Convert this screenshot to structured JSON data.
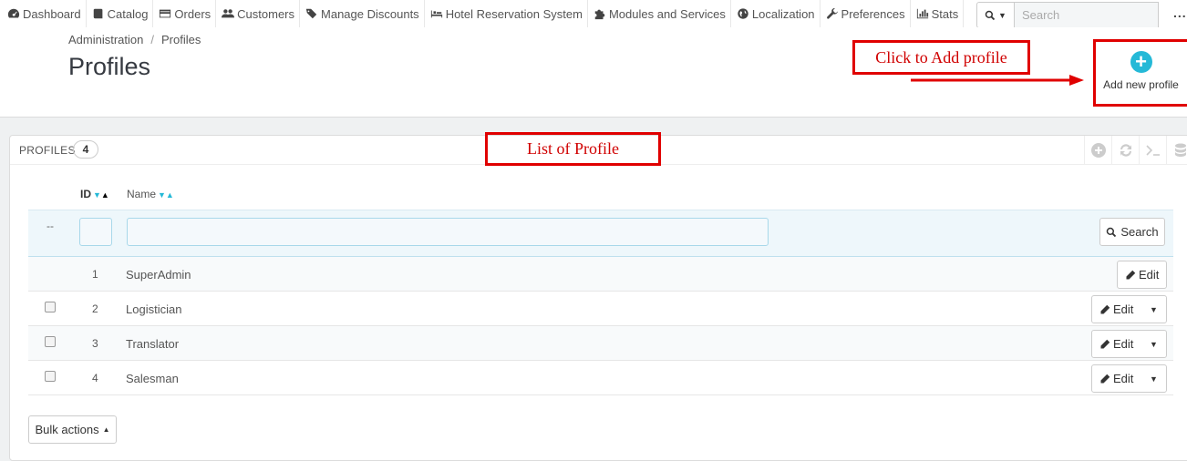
{
  "nav": {
    "items": [
      {
        "label": "Dashboard",
        "icon": "dashboard-icon"
      },
      {
        "label": "Catalog",
        "icon": "book-icon"
      },
      {
        "label": "Orders",
        "icon": "credit-card-icon"
      },
      {
        "label": "Customers",
        "icon": "users-icon"
      },
      {
        "label": "Manage Discounts",
        "icon": "tags-icon"
      },
      {
        "label": "Hotel Reservation System",
        "icon": "bed-icon"
      },
      {
        "label": "Modules and Services",
        "icon": "puzzle-icon"
      },
      {
        "label": "Localization",
        "icon": "globe-icon"
      },
      {
        "label": "Preferences",
        "icon": "wrench-icon"
      },
      {
        "label": "Stats",
        "icon": "bar-chart-icon"
      }
    ],
    "search_placeholder": "Search",
    "more_label": "..."
  },
  "breadcrumb": {
    "parent": "Administration",
    "separator": "/",
    "current": "Profiles"
  },
  "page_title": "Profiles",
  "toolbar": {
    "add_label": "Add new profile"
  },
  "annotations": {
    "add": "Click to Add profile",
    "list": "List of Profile"
  },
  "panel": {
    "title": "PROFILES",
    "count": "4",
    "columns": {
      "id": "ID",
      "name": "Name"
    },
    "filter_dash": "--",
    "search_label": "Search",
    "edit_label": "Edit",
    "bulk_label": "Bulk actions",
    "rows": [
      {
        "id": "1",
        "name": "SuperAdmin"
      },
      {
        "id": "2",
        "name": "Logistician"
      },
      {
        "id": "3",
        "name": "Translator"
      },
      {
        "id": "4",
        "name": "Salesman"
      }
    ]
  },
  "colors": {
    "accent": "#25b9d7",
    "annotation": "#e00000"
  }
}
